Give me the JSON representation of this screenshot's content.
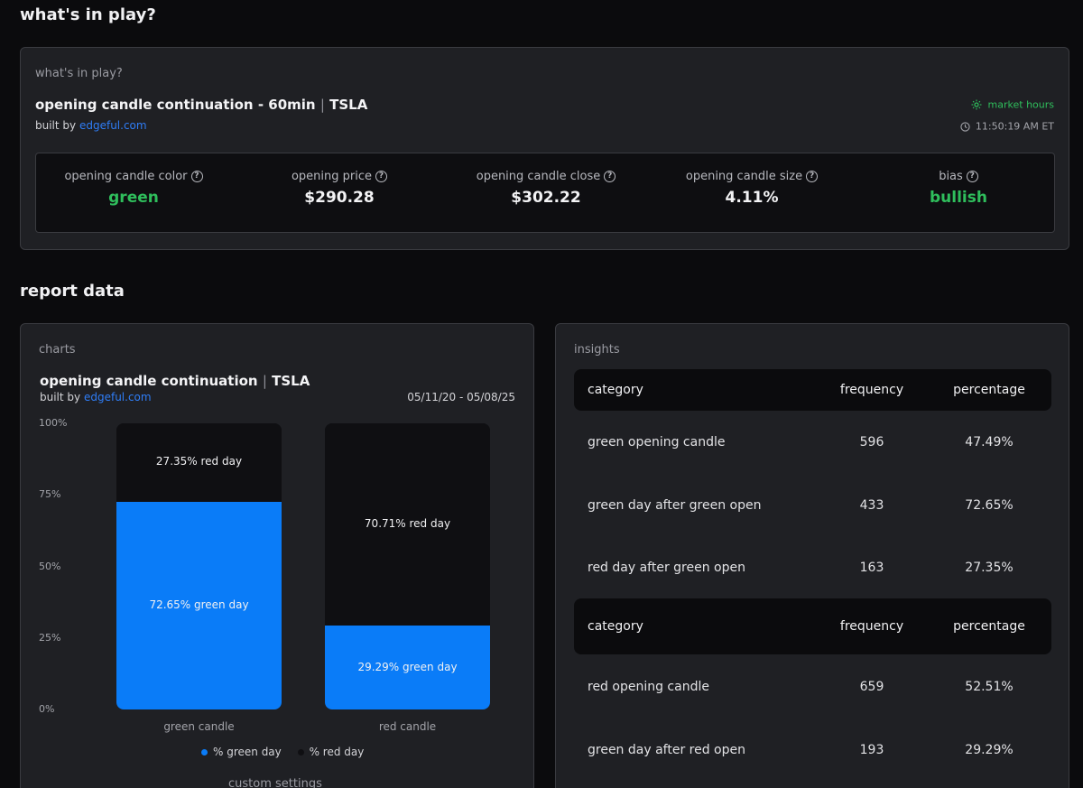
{
  "page": {
    "heading": "what's in play?",
    "report_heading": "report data"
  },
  "play": {
    "label": "what's in play?",
    "title": "opening candle continuation - 60min",
    "ticker": "TSLA",
    "separator": "|",
    "built_by_prefix": "built by",
    "built_by_link": "edgeful.com",
    "market_status": "market hours",
    "time": "11:50:19 AM ET",
    "stats": [
      {
        "label": "opening candle color",
        "value": "green",
        "value_color": "green"
      },
      {
        "label": "opening price",
        "value": "$290.28",
        "value_color": "white"
      },
      {
        "label": "opening candle close",
        "value": "$302.22",
        "value_color": "white"
      },
      {
        "label": "opening candle size",
        "value": "4.11%",
        "value_color": "white"
      },
      {
        "label": "bias",
        "value": "bullish",
        "value_color": "green"
      }
    ]
  },
  "charts": {
    "label": "charts",
    "title": "opening candle continuation",
    "ticker": "TSLA",
    "separator": "|",
    "built_by_prefix": "built by",
    "built_by_link": "edgeful.com",
    "date_range": "05/11/20 - 05/08/25",
    "custom_settings": "custom settings",
    "legend": {
      "green": "% green day",
      "red": "% red day"
    }
  },
  "chart_data": {
    "type": "bar",
    "stacked": true,
    "categories": [
      "green candle",
      "red candle"
    ],
    "series": [
      {
        "name": "% green day",
        "values": [
          72.65,
          29.29
        ],
        "labels": [
          "72.65% green day",
          "29.29% green day"
        ],
        "color": "#0a7cf8"
      },
      {
        "name": "% red day",
        "values": [
          27.35,
          70.71
        ],
        "labels": [
          "27.35% red day",
          "70.71% red day"
        ],
        "color": "#0f0f12"
      }
    ],
    "yticks": [
      "100%",
      "75%",
      "50%",
      "25%",
      "0%"
    ],
    "ylim": [
      0,
      100
    ],
    "legend_position": "bottom"
  },
  "insights": {
    "label": "insights",
    "headers": [
      "category",
      "frequency",
      "percentage"
    ],
    "tables": [
      {
        "rows": [
          [
            "green opening candle",
            "596",
            "47.49%"
          ],
          [
            "green day after green open",
            "433",
            "72.65%"
          ],
          [
            "red day after green open",
            "163",
            "27.35%"
          ]
        ]
      },
      {
        "rows": [
          [
            "red opening candle",
            "659",
            "52.51%"
          ],
          [
            "green day after red open",
            "193",
            "29.29%"
          ]
        ]
      }
    ]
  },
  "colors": {
    "accent_green": "#2fbe5c",
    "link_blue": "#2f7df6",
    "bar_blue": "#0a7cf8",
    "background": "#0b0b0d",
    "panel": "#1f2024"
  }
}
